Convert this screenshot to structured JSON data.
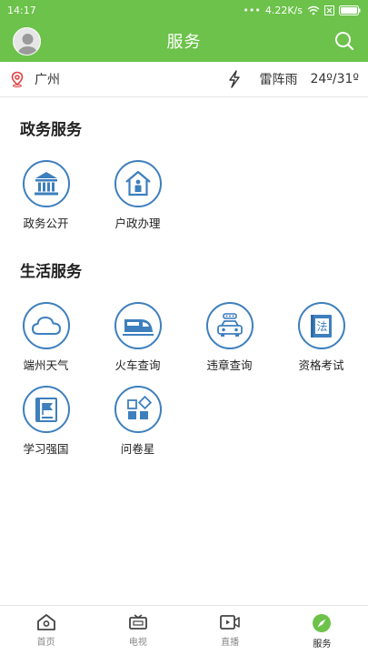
{
  "status_bar": {
    "time": "14:17",
    "network_speed": "4.22K/s",
    "battery_icon": "battery-icon",
    "wifi_icon": "wifi-icon"
  },
  "header": {
    "title": "服务"
  },
  "weather": {
    "city": "广州",
    "condition": "雷阵雨",
    "temperature": "24º/31º"
  },
  "sections": [
    {
      "title": "政务服务",
      "items": [
        {
          "label": "政务公开",
          "icon": "government-building-icon"
        },
        {
          "label": "户政办理",
          "icon": "household-registration-icon"
        }
      ]
    },
    {
      "title": "生活服务",
      "items": [
        {
          "label": "端州天气",
          "icon": "cloud-icon"
        },
        {
          "label": "火车查询",
          "icon": "train-icon"
        },
        {
          "label": "违章查询",
          "icon": "car-icon"
        },
        {
          "label": "资格考试",
          "icon": "law-book-icon"
        },
        {
          "label": "学习强国",
          "icon": "flag-book-icon"
        },
        {
          "label": "问卷星",
          "icon": "survey-blocks-icon"
        }
      ]
    }
  ],
  "tabs": [
    {
      "label": "首页",
      "icon": "home-icon"
    },
    {
      "label": "电视",
      "icon": "tv-icon"
    },
    {
      "label": "直播",
      "icon": "live-video-icon"
    },
    {
      "label": "服务",
      "icon": "compass-icon",
      "active": true
    }
  ],
  "colors": {
    "brand_green": "#6cc24a",
    "icon_blue": "#3e7fbd",
    "location_red": "#e04040"
  }
}
